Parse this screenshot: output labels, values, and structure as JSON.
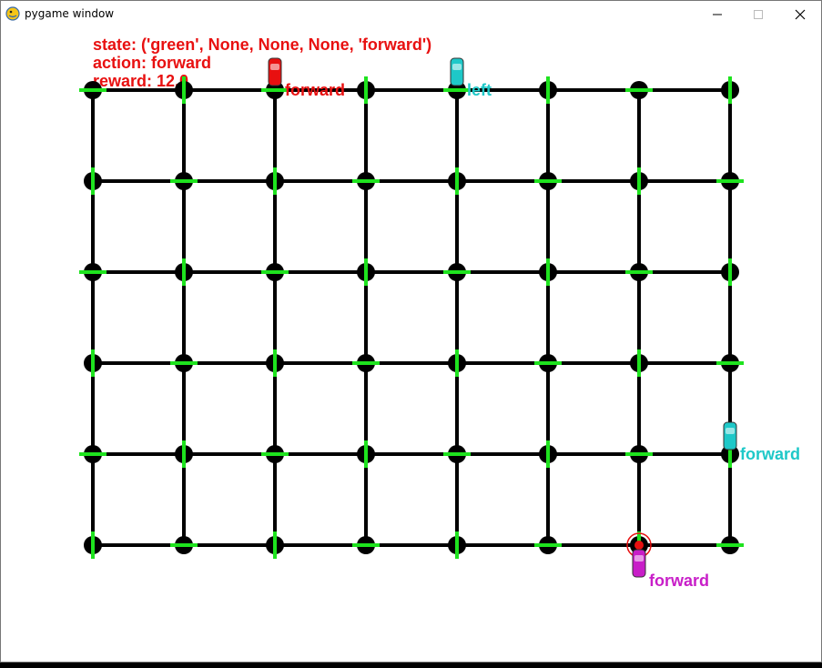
{
  "window": {
    "title": "pygame window",
    "app_icon": "pygame-snake-icon",
    "controls": {
      "minimize_icon": "minimize-icon",
      "maximize_icon": "maximize-icon",
      "close_icon": "close-icon"
    }
  },
  "hud": {
    "state": "state: ('green', None, None, None, 'forward')",
    "action": "action: forward",
    "reward": "reward: 12.0"
  },
  "grid": {
    "columns": 8,
    "rows": 6,
    "road_color": "#000000",
    "signal_color": "#1ee31e"
  },
  "cars": [
    {
      "id": "red",
      "color": "#e81010",
      "label": "forward",
      "col": 2,
      "row": 0,
      "heading": "down",
      "agent": false
    },
    {
      "id": "cyan-top",
      "color": "#1ec8c8",
      "label": "left",
      "col": 4,
      "row": 0,
      "heading": "down",
      "agent": false
    },
    {
      "id": "cyan-right",
      "color": "#1ec8c8",
      "label": "forward",
      "col": 7,
      "row": 4,
      "heading": "down",
      "agent": false
    },
    {
      "id": "magenta",
      "color": "#c81ec8",
      "label": "forward",
      "col": 6,
      "row": 5,
      "heading": "up",
      "agent": true
    }
  ]
}
